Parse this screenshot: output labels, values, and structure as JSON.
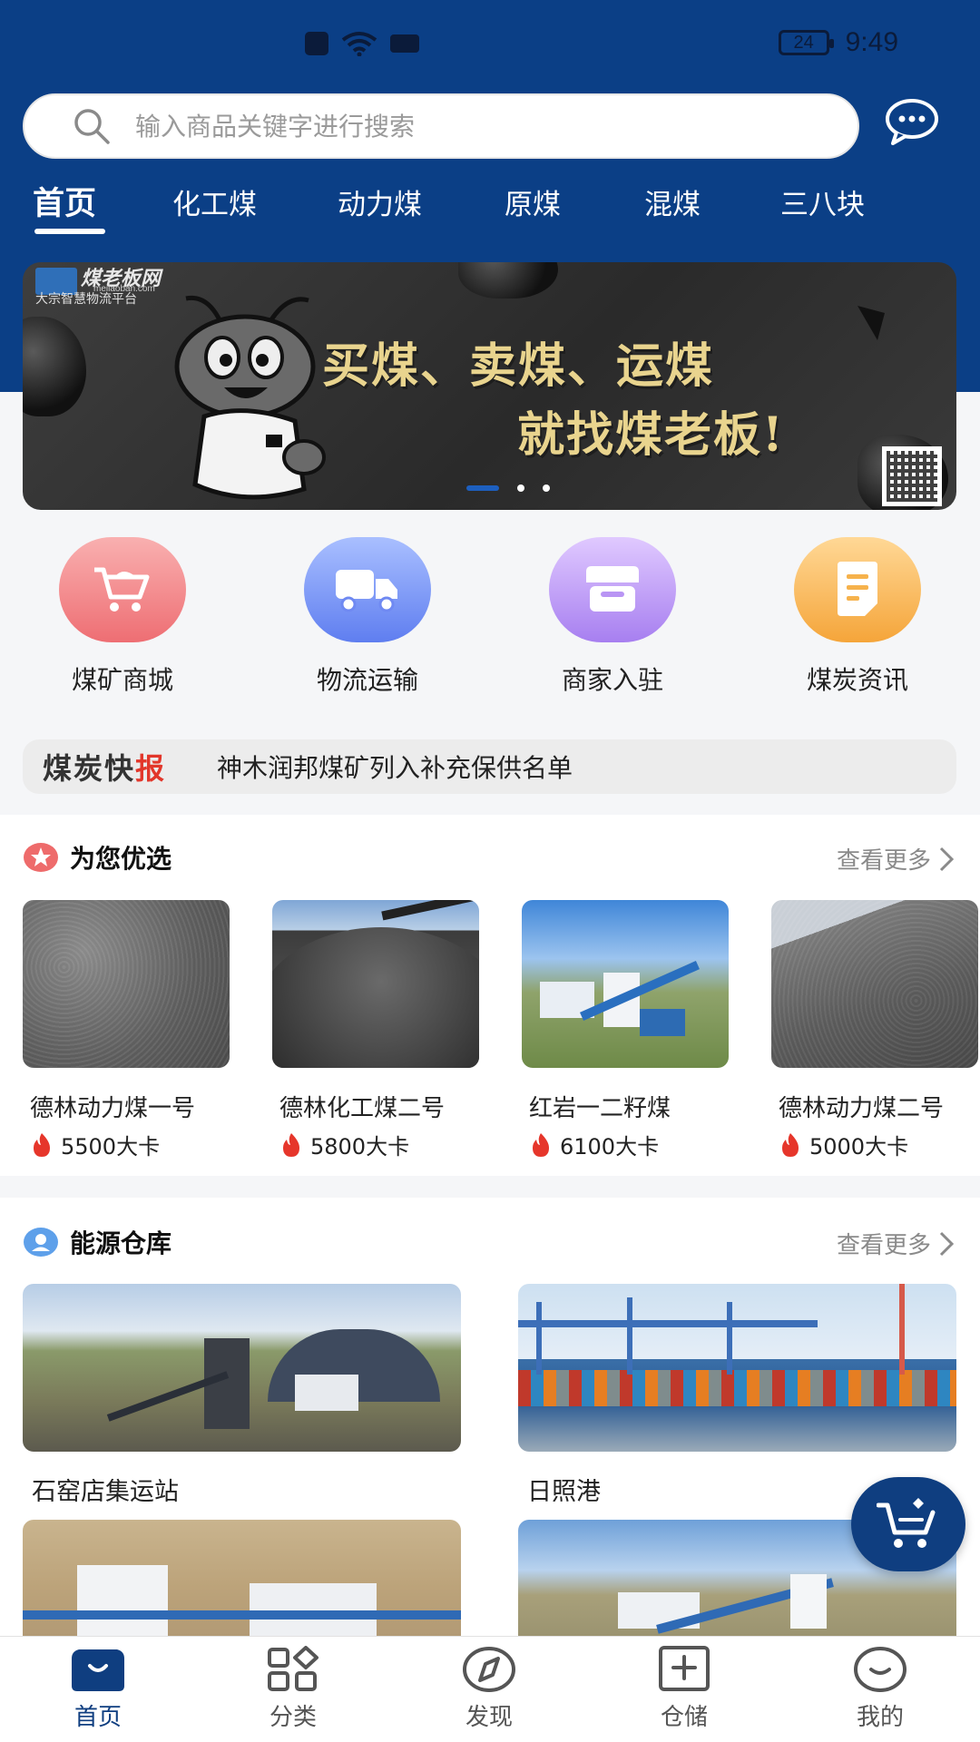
{
  "status_bar": {
    "battery": "24",
    "time": "9:49"
  },
  "search": {
    "placeholder": "输入商品关键字进行搜索"
  },
  "tabs": [
    "首页",
    "化工煤",
    "动力煤",
    "原煤",
    "混煤",
    "三八块"
  ],
  "banner": {
    "logo_text": "煤老板网",
    "logo_url": "meilaoban.com",
    "logo_sub": "大宗智慧物流平台",
    "line1": "买煤、卖煤、运煤",
    "line2": "就找煤老板!"
  },
  "quick_nav": [
    {
      "label": "煤矿商城",
      "icon": "cart-icon",
      "color_from": "#f9a7a7",
      "color_to": "#ee6e73"
    },
    {
      "label": "物流运输",
      "icon": "truck-icon",
      "color_from": "#9fb6ff",
      "color_to": "#5f7ef0"
    },
    {
      "label": "商家入驻",
      "icon": "store-icon",
      "color_from": "#dcc3ff",
      "color_to": "#a77ff0"
    },
    {
      "label": "煤炭资讯",
      "icon": "document-icon",
      "color_from": "#ffd28a",
      "color_to": "#f5a53a"
    }
  ],
  "news": {
    "tag_a": "煤炭快",
    "tag_b": "报",
    "text": "神木润邦煤矿列入补充保供名单"
  },
  "recommend": {
    "title": "为您优选",
    "more": "查看更多",
    "products": [
      {
        "name": "德林动力煤一号",
        "cal": "5500大卡"
      },
      {
        "name": "德林化工煤二号",
        "cal": "5800大卡"
      },
      {
        "name": "红岩一二籽煤",
        "cal": "6100大卡"
      },
      {
        "name": "德林动力煤二号",
        "cal": "5000大卡"
      }
    ]
  },
  "warehouse": {
    "title": "能源仓库",
    "more": "查看更多",
    "items": [
      {
        "name": "石窑店集运站"
      },
      {
        "name": "日照港"
      }
    ]
  },
  "bottom_nav": [
    {
      "label": "首页",
      "icon": "home-icon"
    },
    {
      "label": "分类",
      "icon": "category-icon"
    },
    {
      "label": "发现",
      "icon": "compass-icon"
    },
    {
      "label": "仓储",
      "icon": "warehouse-add-icon"
    },
    {
      "label": "我的",
      "icon": "profile-icon"
    }
  ],
  "colors": {
    "primary": "#0b3f86",
    "accent_red": "#e2372b",
    "flame": "#e6362b"
  }
}
